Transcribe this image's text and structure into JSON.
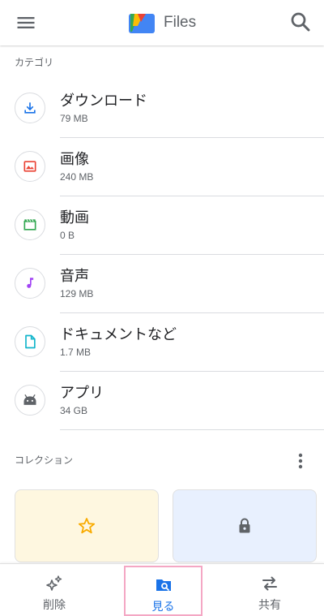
{
  "app": {
    "title": "Files"
  },
  "colors": {
    "accent": "#1a73e8",
    "download": "#1a73e8",
    "images": "#ea4335",
    "videos": "#34a853",
    "audio": "#a142f4",
    "documents": "#12b5cb",
    "apps": "#5f6368",
    "favorites_star": "#f9ab00"
  },
  "categories": {
    "label": "カテゴリ",
    "items": [
      {
        "name": "ダウンロード",
        "size": "79 MB",
        "icon": "download-icon"
      },
      {
        "name": "画像",
        "size": "240 MB",
        "icon": "image-icon"
      },
      {
        "name": "動画",
        "size": "0 B",
        "icon": "video-icon"
      },
      {
        "name": "音声",
        "size": "129 MB",
        "icon": "music-note-icon"
      },
      {
        "name": "ドキュメントなど",
        "size": "1.7 MB",
        "icon": "document-icon"
      },
      {
        "name": "アプリ",
        "size": "34 GB",
        "icon": "android-icon"
      }
    ]
  },
  "collections": {
    "label": "コレクション",
    "cards": [
      {
        "icon": "star-icon"
      },
      {
        "icon": "lock-icon"
      }
    ]
  },
  "bottom_nav": {
    "items": [
      {
        "label": "削除",
        "icon": "sparkle-icon",
        "selected": false
      },
      {
        "label": "見る",
        "icon": "browse-folder-icon",
        "selected": true
      },
      {
        "label": "共有",
        "icon": "swap-arrows-icon",
        "selected": false
      }
    ]
  }
}
